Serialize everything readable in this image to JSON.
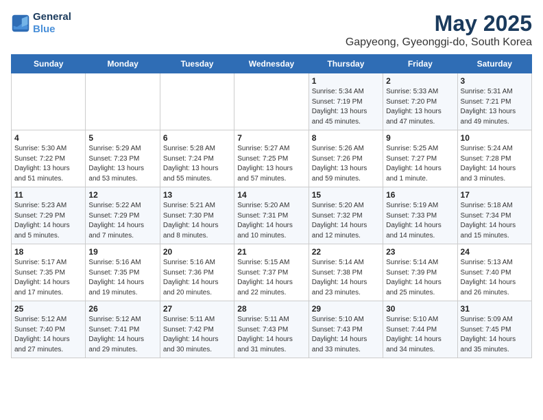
{
  "header": {
    "logo_line1": "General",
    "logo_line2": "Blue",
    "title": "May 2025",
    "subtitle": "Gapyeong, Gyeonggi-do, South Korea"
  },
  "columns": [
    "Sunday",
    "Monday",
    "Tuesday",
    "Wednesday",
    "Thursday",
    "Friday",
    "Saturday"
  ],
  "weeks": [
    [
      {
        "day": "",
        "info": ""
      },
      {
        "day": "",
        "info": ""
      },
      {
        "day": "",
        "info": ""
      },
      {
        "day": "",
        "info": ""
      },
      {
        "day": "1",
        "info": "Sunrise: 5:34 AM\nSunset: 7:19 PM\nDaylight: 13 hours\nand 45 minutes."
      },
      {
        "day": "2",
        "info": "Sunrise: 5:33 AM\nSunset: 7:20 PM\nDaylight: 13 hours\nand 47 minutes."
      },
      {
        "day": "3",
        "info": "Sunrise: 5:31 AM\nSunset: 7:21 PM\nDaylight: 13 hours\nand 49 minutes."
      }
    ],
    [
      {
        "day": "4",
        "info": "Sunrise: 5:30 AM\nSunset: 7:22 PM\nDaylight: 13 hours\nand 51 minutes."
      },
      {
        "day": "5",
        "info": "Sunrise: 5:29 AM\nSunset: 7:23 PM\nDaylight: 13 hours\nand 53 minutes."
      },
      {
        "day": "6",
        "info": "Sunrise: 5:28 AM\nSunset: 7:24 PM\nDaylight: 13 hours\nand 55 minutes."
      },
      {
        "day": "7",
        "info": "Sunrise: 5:27 AM\nSunset: 7:25 PM\nDaylight: 13 hours\nand 57 minutes."
      },
      {
        "day": "8",
        "info": "Sunrise: 5:26 AM\nSunset: 7:26 PM\nDaylight: 13 hours\nand 59 minutes."
      },
      {
        "day": "9",
        "info": "Sunrise: 5:25 AM\nSunset: 7:27 PM\nDaylight: 14 hours\nand 1 minute."
      },
      {
        "day": "10",
        "info": "Sunrise: 5:24 AM\nSunset: 7:28 PM\nDaylight: 14 hours\nand 3 minutes."
      }
    ],
    [
      {
        "day": "11",
        "info": "Sunrise: 5:23 AM\nSunset: 7:29 PM\nDaylight: 14 hours\nand 5 minutes."
      },
      {
        "day": "12",
        "info": "Sunrise: 5:22 AM\nSunset: 7:29 PM\nDaylight: 14 hours\nand 7 minutes."
      },
      {
        "day": "13",
        "info": "Sunrise: 5:21 AM\nSunset: 7:30 PM\nDaylight: 14 hours\nand 8 minutes."
      },
      {
        "day": "14",
        "info": "Sunrise: 5:20 AM\nSunset: 7:31 PM\nDaylight: 14 hours\nand 10 minutes."
      },
      {
        "day": "15",
        "info": "Sunrise: 5:20 AM\nSunset: 7:32 PM\nDaylight: 14 hours\nand 12 minutes."
      },
      {
        "day": "16",
        "info": "Sunrise: 5:19 AM\nSunset: 7:33 PM\nDaylight: 14 hours\nand 14 minutes."
      },
      {
        "day": "17",
        "info": "Sunrise: 5:18 AM\nSunset: 7:34 PM\nDaylight: 14 hours\nand 15 minutes."
      }
    ],
    [
      {
        "day": "18",
        "info": "Sunrise: 5:17 AM\nSunset: 7:35 PM\nDaylight: 14 hours\nand 17 minutes."
      },
      {
        "day": "19",
        "info": "Sunrise: 5:16 AM\nSunset: 7:35 PM\nDaylight: 14 hours\nand 19 minutes."
      },
      {
        "day": "20",
        "info": "Sunrise: 5:16 AM\nSunset: 7:36 PM\nDaylight: 14 hours\nand 20 minutes."
      },
      {
        "day": "21",
        "info": "Sunrise: 5:15 AM\nSunset: 7:37 PM\nDaylight: 14 hours\nand 22 minutes."
      },
      {
        "day": "22",
        "info": "Sunrise: 5:14 AM\nSunset: 7:38 PM\nDaylight: 14 hours\nand 23 minutes."
      },
      {
        "day": "23",
        "info": "Sunrise: 5:14 AM\nSunset: 7:39 PM\nDaylight: 14 hours\nand 25 minutes."
      },
      {
        "day": "24",
        "info": "Sunrise: 5:13 AM\nSunset: 7:40 PM\nDaylight: 14 hours\nand 26 minutes."
      }
    ],
    [
      {
        "day": "25",
        "info": "Sunrise: 5:12 AM\nSunset: 7:40 PM\nDaylight: 14 hours\nand 27 minutes."
      },
      {
        "day": "26",
        "info": "Sunrise: 5:12 AM\nSunset: 7:41 PM\nDaylight: 14 hours\nand 29 minutes."
      },
      {
        "day": "27",
        "info": "Sunrise: 5:11 AM\nSunset: 7:42 PM\nDaylight: 14 hours\nand 30 minutes."
      },
      {
        "day": "28",
        "info": "Sunrise: 5:11 AM\nSunset: 7:43 PM\nDaylight: 14 hours\nand 31 minutes."
      },
      {
        "day": "29",
        "info": "Sunrise: 5:10 AM\nSunset: 7:43 PM\nDaylight: 14 hours\nand 33 minutes."
      },
      {
        "day": "30",
        "info": "Sunrise: 5:10 AM\nSunset: 7:44 PM\nDaylight: 14 hours\nand 34 minutes."
      },
      {
        "day": "31",
        "info": "Sunrise: 5:09 AM\nSunset: 7:45 PM\nDaylight: 14 hours\nand 35 minutes."
      }
    ]
  ]
}
